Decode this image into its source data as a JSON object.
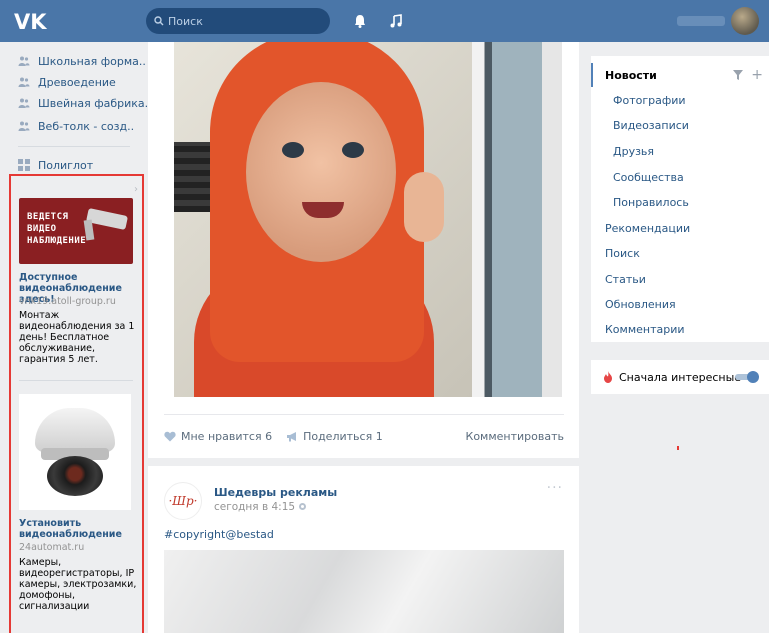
{
  "header": {
    "search_placeholder": "Поиск",
    "icons": [
      "vk-logo-icon",
      "search-icon",
      "bell-icon",
      "music-icon"
    ]
  },
  "left_menu": {
    "groups": [
      {
        "label": "Школьная форма.."
      },
      {
        "label": "Древоедение"
      },
      {
        "label": "Швейная фабрика.."
      },
      {
        "label": "Веб-толк - созд.."
      }
    ],
    "app": {
      "label": "Полиглот"
    }
  },
  "ads": [
    {
      "image_lines": [
        "ВЕДЕТСЯ",
        "ВИДЕО",
        "НАБЛЮДЕНИЕ"
      ],
      "title": "Доступное видеонаблюдение здесь!",
      "domain": "vnk19.atoll-group.ru",
      "text": "Монтаж видеонаблюдения за 1 день! Бесплатное обслуживание, гарантия 5 лет."
    },
    {
      "title": "Установить видеонаблюдение",
      "domain": "24automat.ru",
      "text": "Камеры, видеорегистраторы, IP камеры, электрозамки, домофоны, сигнализации"
    }
  ],
  "post1": {
    "like_label": "Мне нравится",
    "like_count": "6",
    "share_label": "Поделиться",
    "share_count": "1",
    "comment_label": "Комментировать"
  },
  "post2": {
    "author": "Шедевры рекламы",
    "time": "сегодня в 4:15",
    "text": "#copyright@bestad",
    "more": "···"
  },
  "right_nav": {
    "items": [
      {
        "label": "Новости",
        "active": true
      },
      {
        "label": "Фотографии"
      },
      {
        "label": "Видеозаписи"
      },
      {
        "label": "Друзья"
      },
      {
        "label": "Сообщества"
      },
      {
        "label": "Понравилось"
      },
      {
        "label": "Рекомендации"
      },
      {
        "label": "Поиск"
      },
      {
        "label": "Статьи"
      },
      {
        "label": "Обновления"
      },
      {
        "label": "Комментарии"
      }
    ]
  },
  "interesting_first": {
    "label": "Сначала интересные",
    "enabled": true
  },
  "colors": {
    "header": "#4a76a8",
    "link": "#2a5885",
    "highlight_border": "#e53935",
    "background": "#edeef0"
  }
}
